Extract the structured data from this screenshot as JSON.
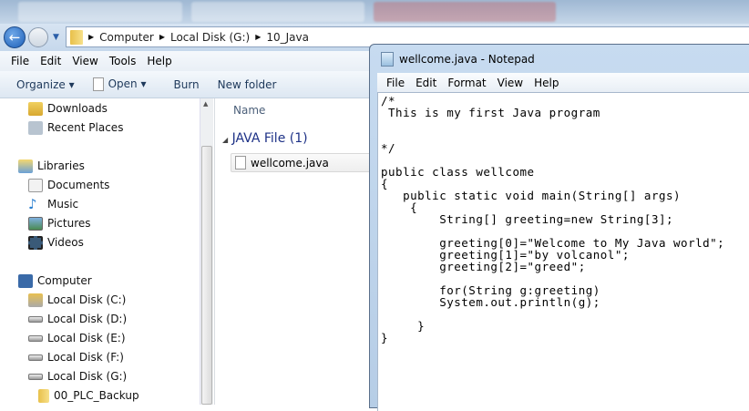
{
  "explorer": {
    "breadcrumb": [
      "Computer",
      "Local Disk (G:)",
      "10_Java"
    ],
    "menu": [
      "File",
      "Edit",
      "View",
      "Tools",
      "Help"
    ],
    "toolbar": {
      "organize": "Organize ▾",
      "open": "Open ▾",
      "burn": "Burn",
      "new_folder": "New folder"
    },
    "nav": [
      {
        "label": "Downloads",
        "icon": "downloads-icon"
      },
      {
        "label": "Recent Places",
        "icon": "recent-places-icon"
      },
      {
        "label": "Libraries",
        "icon": "libraries-icon"
      },
      {
        "label": "Documents",
        "icon": "documents-icon"
      },
      {
        "label": "Music",
        "icon": "music-icon"
      },
      {
        "label": "Pictures",
        "icon": "pictures-icon"
      },
      {
        "label": "Videos",
        "icon": "videos-icon"
      },
      {
        "label": "Computer",
        "icon": "computer-icon"
      },
      {
        "label": "Local Disk (C:)",
        "icon": "drive-icon"
      },
      {
        "label": "Local Disk (D:)",
        "icon": "drive-icon"
      },
      {
        "label": "Local Disk (E:)",
        "icon": "drive-icon"
      },
      {
        "label": "Local Disk (F:)",
        "icon": "drive-icon"
      },
      {
        "label": "Local Disk (G:)",
        "icon": "drive-icon"
      },
      {
        "label": "00_PLC_Backup",
        "icon": "folder-icon"
      }
    ],
    "column_name": "Name",
    "group_header": "JAVA File (1)",
    "files": [
      "wellcome.java"
    ]
  },
  "notepad": {
    "title": "wellcome.java - Notepad",
    "menu": [
      "File",
      "Edit",
      "Format",
      "View",
      "Help"
    ],
    "content": "/*\n This is my first Java program\n\n\n*/\n\npublic class wellcome\n{\n   public static void main(String[] args)\n    {\n        String[] greeting=new String[3];\n\n        greeting[0]=\"Welcome to My Java world\";\n        greeting[1]=\"by volcanol\";\n        greeting[2]=\"greed\";\n\n        for(String g:greeting)\n        System.out.println(g);\n\n     }\n}"
  }
}
